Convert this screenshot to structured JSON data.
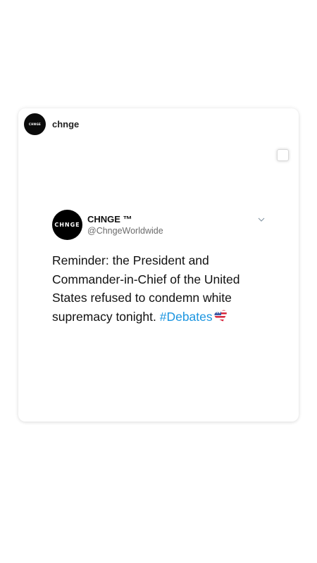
{
  "post": {
    "avatar_text": "CHNGE",
    "username": "chnge"
  },
  "tweet": {
    "avatar_text": "CHNGE",
    "display_name": "CHNGE ™",
    "handle": "@ChngeWorldwide",
    "text_before_hashtag": "Reminder: the President and Commander-in-Chief of the United States refused to condemn white supremacy tonight. ",
    "hashtag": "#Debates",
    "hashtag_color": "#1b95e0",
    "emoji_icon": "us-flag-heart-emoji"
  }
}
